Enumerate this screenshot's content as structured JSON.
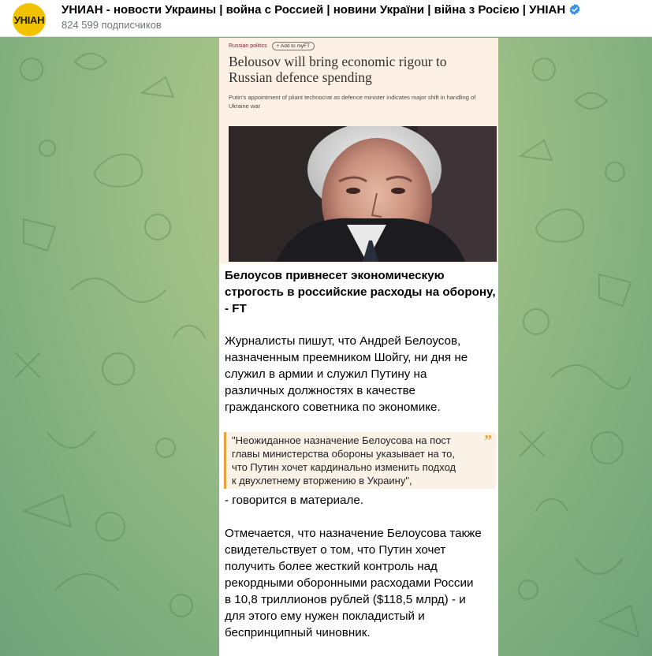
{
  "header": {
    "avatar_text": "УНІАН",
    "channel_title": "УНИАН - новости Украины | война с Россией | новини України | війна з Росією | УНІАН",
    "subscribers": "824 599 подписчиков",
    "verified_icon": "verified-icon"
  },
  "article_image": {
    "section": "Russian politics",
    "add_button": "+ Add to myFT",
    "headline": "Belousov will bring economic rigour to Russian defence spending",
    "standfirst": "Putin's appointment of pliant technocrat as defence minister indicates major shift in handling of Ukraine war"
  },
  "post": {
    "title_lines": [
      "Белоусов привнесет экономическую",
      "строгость в российские расходы на оборону,",
      "- FT"
    ],
    "para1_lines": [
      "Журналисты пишут, что Андрей Белоусов,",
      "назначенным преемником Шойгу, ни дня не",
      "служил в армии и служил Путину на",
      "различных должностях в качестве",
      "гражданского советника по экономике."
    ],
    "quote_lines": [
      "\"Неожиданное назначение Белоусова на пост",
      "главы министерства обороны указывает на то,",
      "что Путин хочет кардинально изменить подход",
      "к двухлетнему вторжению в Украину\","
    ],
    "quote_icon": "”",
    "after_quote": "- говорится в материале.",
    "para2_lines": [
      "Отмечается, что назначение Белоусова также",
      "свидетельствует о том, что Путин хочет",
      "получить более жесткий контроль над",
      "рекордными оборонными расходами России",
      "в 10,8 триллионов рублей ($118,5 млрд) - и",
      "для этого ему нужен покладистый и",
      "беспринципный чиновник."
    ]
  },
  "colors": {
    "accent": "#3390ec",
    "quote_border": "#e8a23b",
    "ft_background": "#fdf1e5"
  }
}
